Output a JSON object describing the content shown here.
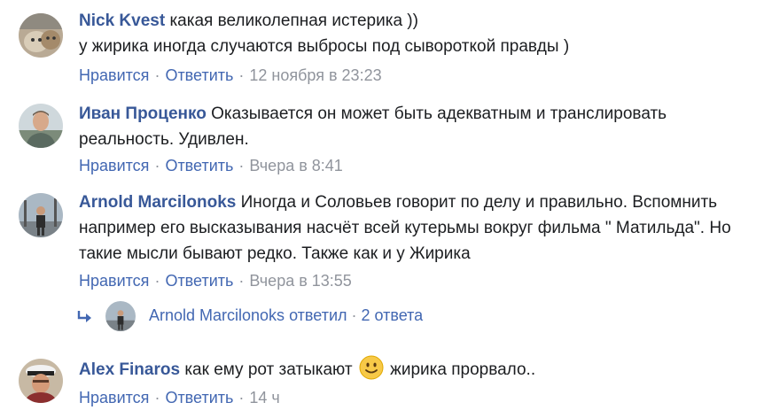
{
  "comments": [
    {
      "author": "Nick Kvest",
      "text": " какая великолепная истерика ))\nу жирика иногда случаются выбросы под сывороткой правды )",
      "like": "Нравится",
      "reply": "Ответить",
      "time": "12 ноября в 23:23",
      "avatar_icon": "cat-avatar-icon"
    },
    {
      "author": "Иван Проценко",
      "text": " Оказывается он может быть адекватным и транслировать реальность. Удивлен.",
      "like": "Нравится",
      "reply": "Ответить",
      "time": "Вчера в 8:41",
      "avatar_icon": "man-avatar-icon"
    },
    {
      "author": "Arnold Marcilonoks",
      "text": " Иногда и Соловьев говорит по делу и правильно. Вспомнить например его высказывания насчёт всей кутерьмы вокруг фильма \" Матильда\". Но такие мысли бывают редко. Также как и у Жирика",
      "like": "Нравится",
      "reply": "Ответить",
      "time": "Вчера в 13:55",
      "avatar_icon": "man-standing-avatar-icon"
    },
    {
      "author": "Alex Finaros",
      "text_before": " как ему рот затыкают ",
      "text_after": " жирика прорвало..",
      "emoji_icon": "smiling-face-emoji-icon",
      "like": "Нравится",
      "reply": "Ответить",
      "time": "14 ч",
      "avatar_icon": "sailor-cap-avatar-icon"
    }
  ],
  "replies_summary": {
    "author": "Arnold Marcilonoks",
    "verb": " ответил",
    "separator": " · ",
    "count_text": "2 ответа",
    "arrow_icon": "reply-arrow-icon"
  },
  "separator": "·",
  "colors": {
    "link": "#4267b2",
    "author": "#385898",
    "meta": "#90949c",
    "text": "#1c1e21"
  }
}
